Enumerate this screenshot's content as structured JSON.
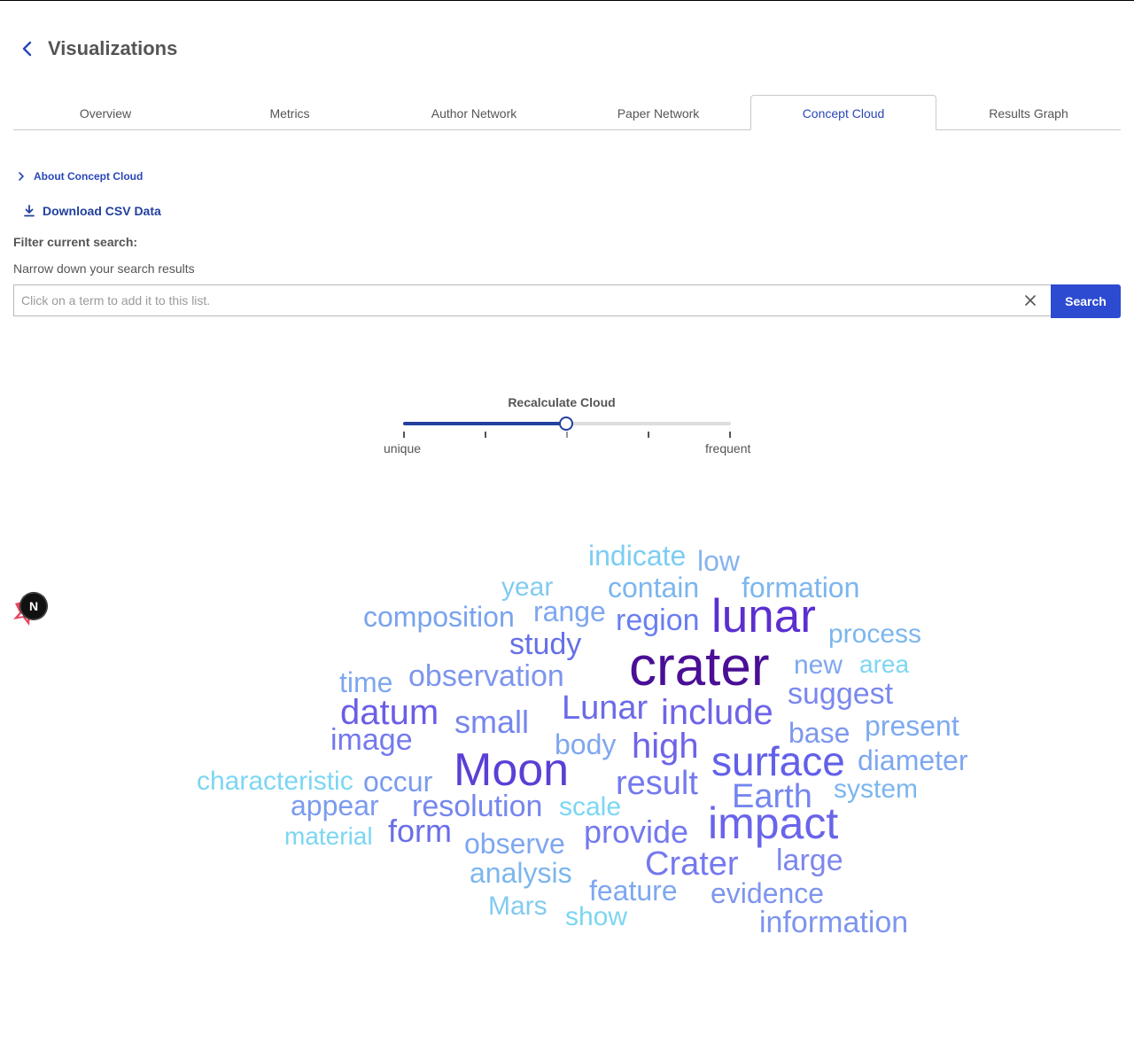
{
  "header": {
    "title": "Visualizations"
  },
  "tabs": [
    {
      "label": "Overview"
    },
    {
      "label": "Metrics"
    },
    {
      "label": "Author Network"
    },
    {
      "label": "Paper Network"
    },
    {
      "label": "Concept Cloud"
    },
    {
      "label": "Results Graph"
    }
  ],
  "active_tab": "Concept Cloud",
  "about": {
    "label": "About Concept Cloud"
  },
  "download": {
    "label": "Download CSV Data"
  },
  "filter": {
    "title": "Filter current search:",
    "subtitle": "Narrow down your search results",
    "placeholder": "Click on a term to add it to this list.",
    "search_label": "Search"
  },
  "slider": {
    "title": "Recalculate Cloud",
    "min_label": "unique",
    "max_label": "frequent",
    "value": 0.5,
    "ticks": 5
  },
  "colors": {
    "accent": "#2a47b8",
    "button": "#2d4bd1"
  },
  "cloud_words": [
    {
      "text": "indicate",
      "color": "#7ccdf2"
    },
    {
      "text": "low",
      "color": "#86b4f0"
    },
    {
      "text": "year",
      "color": "#82cbf0"
    },
    {
      "text": "contain",
      "color": "#7cb6ee"
    },
    {
      "text": "formation",
      "color": "#7cb6ee"
    },
    {
      "text": "composition",
      "color": "#78a3f0"
    },
    {
      "text": "range",
      "color": "#7ea7f0"
    },
    {
      "text": "region",
      "color": "#6a7ef0"
    },
    {
      "text": "lunar",
      "color": "#5b2fcf"
    },
    {
      "text": "process",
      "color": "#7cb6ee"
    },
    {
      "text": "study",
      "color": "#6670e6"
    },
    {
      "text": "crater",
      "color": "#4a0f95"
    },
    {
      "text": "new",
      "color": "#7ea7f0"
    },
    {
      "text": "area",
      "color": "#7cd6f2"
    },
    {
      "text": "time",
      "color": "#7ea7f0"
    },
    {
      "text": "observation",
      "color": "#7d95ee"
    },
    {
      "text": "suggest",
      "color": "#7a88ee"
    },
    {
      "text": "datum",
      "color": "#6a5ee6"
    },
    {
      "text": "small",
      "color": "#7586ee"
    },
    {
      "text": "Lunar",
      "color": "#6b6be8"
    },
    {
      "text": "include",
      "color": "#6e64e8"
    },
    {
      "text": "base",
      "color": "#7d97ee"
    },
    {
      "text": "present",
      "color": "#7eaaf0"
    },
    {
      "text": "image",
      "color": "#7479ee"
    },
    {
      "text": "body",
      "color": "#7ea7f0"
    },
    {
      "text": "high",
      "color": "#6e64e8"
    },
    {
      "text": "Moon",
      "color": "#5b3fd6"
    },
    {
      "text": "surface",
      "color": "#6260e8"
    },
    {
      "text": "diameter",
      "color": "#7ea7f0"
    },
    {
      "text": "characteristic",
      "color": "#7cd6f2"
    },
    {
      "text": "occur",
      "color": "#7a9bef"
    },
    {
      "text": "result",
      "color": "#7479ee"
    },
    {
      "text": "Earth",
      "color": "#7586ee"
    },
    {
      "text": "system",
      "color": "#7cb6ee"
    },
    {
      "text": "appear",
      "color": "#7a9bef"
    },
    {
      "text": "resolution",
      "color": "#7586ee"
    },
    {
      "text": "scale",
      "color": "#7cd6f2"
    },
    {
      "text": "impact",
      "color": "#6a64ea"
    },
    {
      "text": "material",
      "color": "#7cd6f2"
    },
    {
      "text": "form",
      "color": "#6a6ee8"
    },
    {
      "text": "observe",
      "color": "#7ea7f0"
    },
    {
      "text": "provide",
      "color": "#7479ee"
    },
    {
      "text": "Crater",
      "color": "#7479ee"
    },
    {
      "text": "large",
      "color": "#7d86ee"
    },
    {
      "text": "analysis",
      "color": "#7cb6ee"
    },
    {
      "text": "feature",
      "color": "#7ea7f0"
    },
    {
      "text": "evidence",
      "color": "#7d95ee"
    },
    {
      "text": "Mars",
      "color": "#82cbf0"
    },
    {
      "text": "show",
      "color": "#7cd6f2"
    },
    {
      "text": "information",
      "color": "#7d95ee"
    }
  ],
  "badge": {
    "letter": "N"
  }
}
